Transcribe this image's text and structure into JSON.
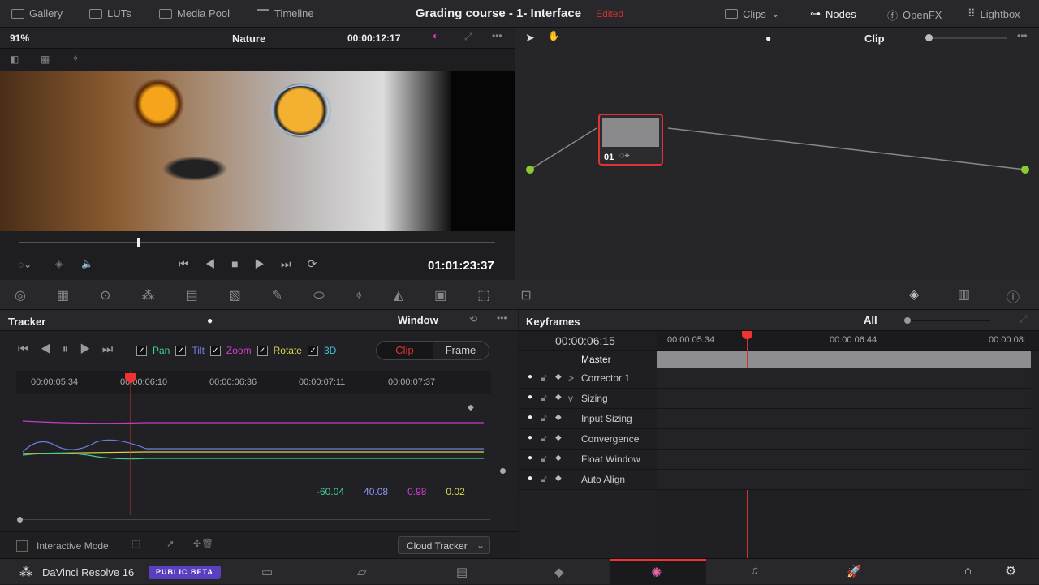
{
  "topbar": {
    "gallery": "Gallery",
    "luts": "LUTs",
    "media_pool": "Media Pool",
    "timeline": "Timeline",
    "title": "Grading course - 1- Interface",
    "edited": "Edited",
    "clips": "Clips",
    "nodes": "Nodes",
    "openfx": "OpenFX",
    "lightbox": "Lightbox"
  },
  "viewer": {
    "zoom": "91%",
    "clip_name": "Nature",
    "timecode": "00:00:12:17",
    "playhead_tc": "01:01:23:37"
  },
  "nodes": {
    "mode": "Clip",
    "node_label": "01"
  },
  "tracker": {
    "title": "Tracker",
    "mode": "Window",
    "checks": [
      {
        "label": "Pan",
        "color": "#3fcf8e"
      },
      {
        "label": "Tilt",
        "color": "#6f7fe0"
      },
      {
        "label": "Zoom",
        "color": "#d43fd0"
      },
      {
        "label": "Rotate",
        "color": "#d8d84a"
      },
      {
        "label": "3D",
        "color": "#3fc8e0"
      }
    ],
    "clip": "Clip",
    "frame": "Frame",
    "ruler": [
      "00:00:05:34",
      "00:00:06:10",
      "00:00:06:36",
      "00:00:07:11",
      "00:00:07:37"
    ],
    "values": [
      {
        "v": "-60.04",
        "color": "#3fcf8e"
      },
      {
        "v": "40.08",
        "color": "#8a9af0"
      },
      {
        "v": "0.98",
        "color": "#d43fd0"
      },
      {
        "v": "0.02",
        "color": "#d8d84a"
      }
    ],
    "interactive_mode": "Interactive Mode",
    "cloud_tracker": "Cloud Tracker"
  },
  "keyframes": {
    "title": "Keyframes",
    "filter": "All",
    "timecode": "00:00:06:15",
    "ruler": [
      "00:00:05:34",
      "00:00:06:44",
      "00:00:08:"
    ],
    "master": "Master",
    "rows": [
      {
        "label": "Corrector 1",
        "chev": ">"
      },
      {
        "label": "Sizing",
        "chev": "v"
      },
      {
        "label": "Input Sizing",
        "chev": ""
      },
      {
        "label": "Convergence",
        "chev": ""
      },
      {
        "label": "Float Window",
        "chev": ""
      },
      {
        "label": "Auto Align",
        "chev": ""
      }
    ]
  },
  "footer": {
    "app": "DaVinci Resolve 16",
    "badge": "PUBLIC BETA"
  }
}
